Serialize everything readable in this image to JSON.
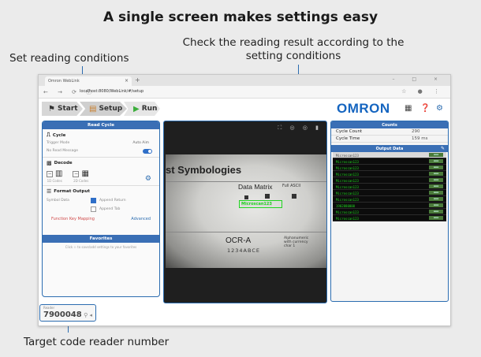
{
  "headline": "A single screen makes settings easy",
  "callouts": {
    "reading": "Set reading conditions",
    "result": "Check the reading result according to the setting conditions",
    "target": "Target code reader number"
  },
  "browser": {
    "tab_title": "Omron WebLink",
    "url": "localhost:8080/WebLink/#/setup"
  },
  "toolbar": {
    "start": "Start",
    "setup": "Setup",
    "run": "Run",
    "logo": "OMRON"
  },
  "left_panel": {
    "title": "Read Cycle",
    "cycle": {
      "header": "Cycle",
      "trigger_label": "Trigger Mode",
      "trigger_value": "Auto Aim",
      "no_read_label": "No Read Message"
    },
    "decode": {
      "header": "Decode",
      "left_sub": "1D Codes",
      "right_sub": "2D Codes"
    },
    "format": {
      "header": "Format Output",
      "symbol_label": "Symbol Data",
      "append_return": "Append Return",
      "append_tab": "Append Tab",
      "function_key": "Function Key Mapping",
      "advanced": "Advanced"
    },
    "favorites": {
      "title": "Favorites",
      "hint": "Click ✩ to save/add settings to your favorites"
    }
  },
  "camera": {
    "title": "st Symbologies",
    "data_matrix": "Data Matrix",
    "full_ascii": "Full ASCII",
    "result": "Microscan123",
    "ocr": "OCR-A",
    "ocr_digits": "1234ABCE",
    "alphanumeric": "Alphanumeric with currency char 1"
  },
  "right_panel": {
    "counts_title": "Counts",
    "cycle_count_label": "Cycle Count",
    "cycle_count_value": "290",
    "cycle_time_label": "Cycle Time",
    "cycle_time_value": "159 ms",
    "output_title": "Output Data",
    "rows": [
      "Microscan123",
      "Microscan123",
      "Microscan123",
      "Microscan123",
      "Microscan123",
      "Microscan123",
      "Microscan123",
      "Microscan123",
      "1902880000",
      "Microscan123",
      "Microscan123"
    ]
  },
  "reader": {
    "label": "Reader",
    "number": "7900048"
  },
  "colors": {
    "accent": "#2b6cb0",
    "panel_header": "#3a6fb5",
    "result_green": "#1fd41f"
  }
}
